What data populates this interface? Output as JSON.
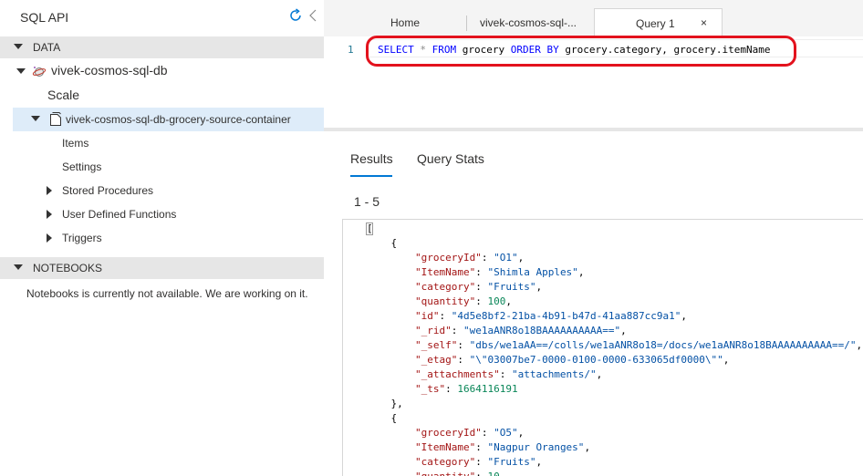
{
  "left_pane": {
    "title": "SQL API",
    "refresh_icon": "refresh-icon",
    "collapse_icon": "chevron-left-icon",
    "data_section": "DATA",
    "database": "vivek-cosmos-sql-db",
    "scale": "Scale",
    "container": "vivek-cosmos-sql-db-grocery-source-container",
    "items": "Items",
    "settings": "Settings",
    "stored_procedures": "Stored Procedures",
    "udfs": "User Defined Functions",
    "triggers": "Triggers",
    "notebooks_section": "NOTEBOOKS",
    "notebooks_message": "Notebooks is currently not available. We are working on it."
  },
  "tabs": {
    "home": "Home",
    "db_tab": "vivek-cosmos-sql-...",
    "query_tab": "Query 1",
    "close": "×"
  },
  "editor": {
    "line_number": "1",
    "tokens": {
      "select": "SELECT",
      "star": "*",
      "from": "FROM",
      "collection": "grocery",
      "order_by": "ORDER BY",
      "rest": "grocery.category, grocery.itemName"
    }
  },
  "results": {
    "results_tab": "Results",
    "stats_tab": "Query Stats",
    "count": "1 - 5",
    "open_bracket": "[",
    "documents": [
      {
        "groceryId": "O1",
        "ItemName": "Shimla Apples",
        "category": "Fruits",
        "quantity": "100",
        "id": "4d5e8bf2-21ba-4b91-b47d-41aa887cc9a1",
        "_rid": "we1aANR8o18BAAAAAAAAAA==",
        "_self": "dbs/we1aAA==/colls/we1aANR8o18=/docs/we1aANR8o18BAAAAAAAAAA==/",
        "_etag": "\\\"03007be7-0000-0100-0000-633065df0000\\\"",
        "_attachments": "attachments/",
        "_ts": "1664116191"
      },
      {
        "groceryId": "O5",
        "ItemName": "Nagpur Oranges",
        "category": "Fruits",
        "quantity": "10"
      }
    ]
  },
  "colors": {
    "accent": "#0078d4",
    "highlight": "#e3121d",
    "selected_row": "#deecf9"
  }
}
